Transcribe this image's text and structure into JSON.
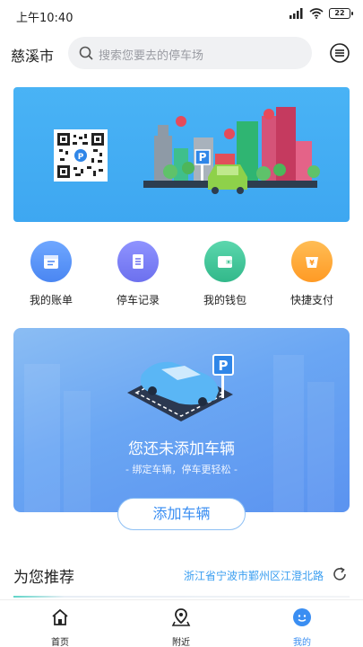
{
  "status_bar": {
    "time": "上午10:40",
    "battery": "22"
  },
  "header": {
    "city": "慈溪市",
    "search_placeholder": "搜索您要去的停车场"
  },
  "quick_actions": [
    {
      "label": "我的账单",
      "icon": "bill-icon",
      "color": "#5c8ef6"
    },
    {
      "label": "停车记录",
      "icon": "record-icon",
      "color": "#7b7ff3"
    },
    {
      "label": "我的钱包",
      "icon": "wallet-icon",
      "color": "#3fc59a"
    },
    {
      "label": "快捷支付",
      "icon": "quick-pay-icon",
      "color": "#ffa535"
    }
  ],
  "vehicle_card": {
    "title": "您还未添加车辆",
    "subtitle": "- 绑定车辆，停车更轻松 -",
    "button": "添加车辆"
  },
  "recommend": {
    "title": "为您推荐",
    "location": "浙江省宁波市鄞州区江澄北路"
  },
  "bottom_nav": [
    {
      "label": "首页",
      "icon": "home-icon",
      "active": false
    },
    {
      "label": "附近",
      "icon": "location-pin-icon",
      "active": false
    },
    {
      "label": "我的",
      "icon": "profile-icon",
      "active": true
    }
  ],
  "colors": {
    "accent": "#3a8ef2",
    "banner": "#46b0f4"
  }
}
